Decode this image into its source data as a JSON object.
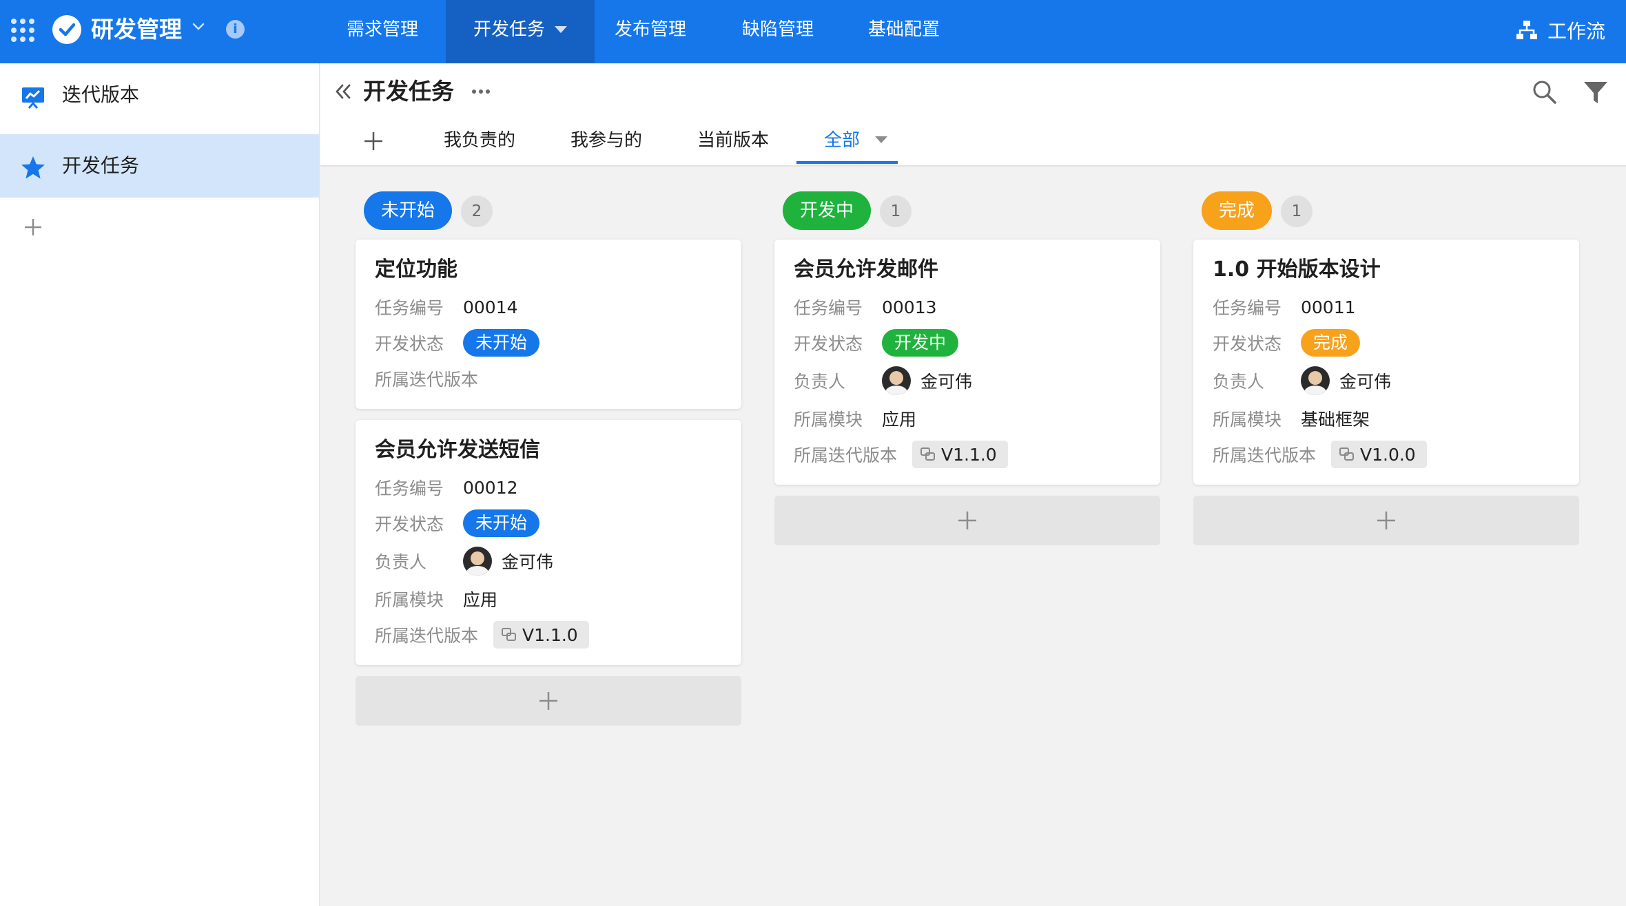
{
  "app": {
    "title": "研发管理"
  },
  "colors": {
    "primary": "#1677ea",
    "not_started": "#1677ea",
    "in_progress": "#1fb33d",
    "done": "#f8a11b"
  },
  "nav": [
    {
      "label": "需求管理"
    },
    {
      "label": "开发任务"
    },
    {
      "label": "发布管理"
    },
    {
      "label": "缺陷管理"
    },
    {
      "label": "基础配置"
    }
  ],
  "workflow_label": "工作流",
  "sidebar": {
    "items": [
      {
        "label": "迭代版本",
        "icon": "chart-board-icon"
      },
      {
        "label": "开发任务",
        "icon": "star-icon"
      }
    ]
  },
  "page": {
    "title": "开发任务"
  },
  "tabs": [
    {
      "label": "我负责的"
    },
    {
      "label": "我参与的"
    },
    {
      "label": "当前版本"
    },
    {
      "label": "全部"
    }
  ],
  "field_labels": {
    "task_no": "任务编号",
    "dev_status": "开发状态",
    "owner": "负责人",
    "module": "所属模块",
    "version": "所属迭代版本"
  },
  "columns": [
    {
      "status": "未开始",
      "count": "2",
      "cards": [
        {
          "title": "定位功能",
          "task_no": "00014",
          "status": "未开始"
        },
        {
          "title": "会员允许发送短信",
          "task_no": "00012",
          "status": "未开始",
          "owner": "金可伟",
          "module": "应用",
          "version": "V1.1.0"
        }
      ]
    },
    {
      "status": "开发中",
      "count": "1",
      "cards": [
        {
          "title": "会员允许发邮件",
          "task_no": "00013",
          "status": "开发中",
          "owner": "金可伟",
          "module": "应用",
          "version": "V1.1.0"
        }
      ]
    },
    {
      "status": "完成",
      "count": "1",
      "cards": [
        {
          "title": "1.0 开始版本设计",
          "task_no": "00011",
          "status": "完成",
          "owner": "金可伟",
          "module": "基础框架",
          "version": "V1.0.0"
        }
      ]
    }
  ]
}
